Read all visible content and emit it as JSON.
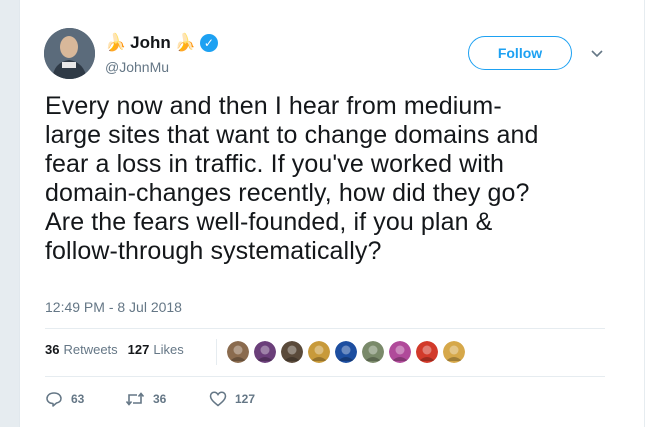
{
  "user": {
    "name": "John",
    "name_emoji": "🍌",
    "handle": "@JohnMu",
    "verified_icon": "verified-badge-icon"
  },
  "follow_label": "Follow",
  "tweet": {
    "text": "Every now and then I hear from medium-\nlarge sites that want to change domains and\nfear a loss in traffic. If you've worked with\ndomain-changes recently, how did they go?\nAre the fears well-founded, if you plan &\nfollow-through systematically?",
    "timestamp": "12:49 PM - 8 Jul 2018"
  },
  "stats": {
    "retweets_count": "36",
    "retweets_label": "Retweets",
    "likes_count": "127",
    "likes_label": "Likes"
  },
  "liker_avatar_colors": [
    "#8a6b4e",
    "#6b3f7a",
    "#5a4a3a",
    "#c89a3a",
    "#1d4ea0",
    "#7a8a6a",
    "#b04a9a",
    "#d23a2a",
    "#d6a84a"
  ],
  "actions": {
    "replies": "63",
    "retweets": "36",
    "likes": "127"
  },
  "colors": {
    "accent": "#1da1f2",
    "text": "#14171a",
    "muted": "#657786",
    "background": "#e6ecf0"
  }
}
